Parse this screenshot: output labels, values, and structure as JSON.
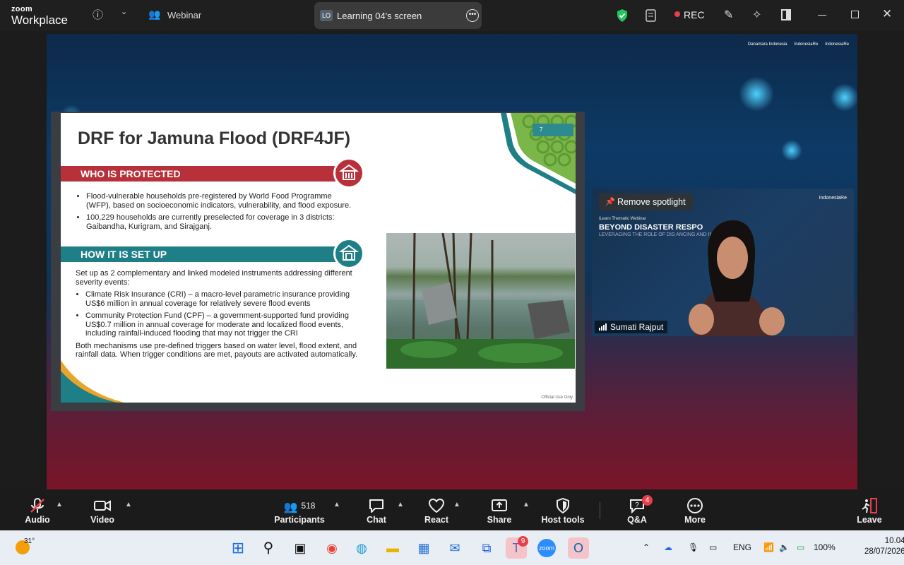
{
  "topbar": {
    "brand_line1": "zoom",
    "brand_line2": "Workplace",
    "meeting_label": "Webinar",
    "share_avatar": "LO",
    "share_title": "Learning 04's screen",
    "rec_label": "REC",
    "icons": [
      "info-icon",
      "chevron-down-icon",
      "people-icon",
      "more-icon",
      "shield-icon",
      "notes-icon",
      "rec-icon",
      "pen-icon",
      "sparkle-icon",
      "panel-icon",
      "minimize-icon",
      "restore-icon",
      "close-icon"
    ]
  },
  "slide": {
    "title": "DRF for Jamuna Flood (DRF4JF)",
    "page_number": "7",
    "section1_title": "WHO IS PROTECTED",
    "section1_bullets": [
      "Flood-vulnerable households pre-registered by World Food Programme (WFP), based on socioeconomic indicators, vulnerability, and flood exposure.",
      "100,229 households are currently preselected for coverage in 3 districts: Gaibandha, Kurigram, and Sirajganj."
    ],
    "section2_title": "HOW IT IS SET UP",
    "section2_intro": "Set up as 2 complementary and linked modeled instruments addressing different severity events:",
    "section2_bullets": [
      "Climate Risk Insurance (CRI) – a macro-level parametric insurance providing US$6 million in annual coverage for relatively severe flood events",
      "Community Protection Fund (CPF) – a government-supported fund providing US$0.7 million in annual coverage for moderate and localized flood events, including rainfall-induced flooding that may not trigger the CRI"
    ],
    "section2_outro": "Both mechanisms use pre-defined triggers based on water level, flood extent, and rainfall data. When trigger conditions are met, payouts are activated automatically.",
    "footer": "Official Use Only",
    "colors": {
      "red": "#b8313a",
      "teal": "#1f7f86",
      "green": "#8dc63f"
    }
  },
  "stage": {
    "logos": [
      "Danantara Indonesia",
      "IndonesiaRe",
      "IndonesiaRe"
    ]
  },
  "video": {
    "spotlight_label": "Remove spotlight",
    "webinar_small": "iLearn Thematic Webinar",
    "webinar_title": "BEYOND DISASTER RESPO",
    "webinar_subtitle": "LEVERAGING THE ROLE OF DIS            ANCING AND INSURANCE",
    "logo": "IndonesiaRe",
    "speaker_name": "Sumati Rajput"
  },
  "toolbar": {
    "audio": "Audio",
    "video": "Video",
    "participants": "Participants",
    "participants_count": "518",
    "chat": "Chat",
    "react": "React",
    "share": "Share",
    "host_tools": "Host tools",
    "qa": "Q&A",
    "qa_badge": "4",
    "more": "More",
    "leave": "Leave"
  },
  "taskbar": {
    "weather": "31°",
    "language": "ENG",
    "battery": "100%",
    "time": "10.04",
    "date": "28/07/2026",
    "teams_badge": "9"
  }
}
